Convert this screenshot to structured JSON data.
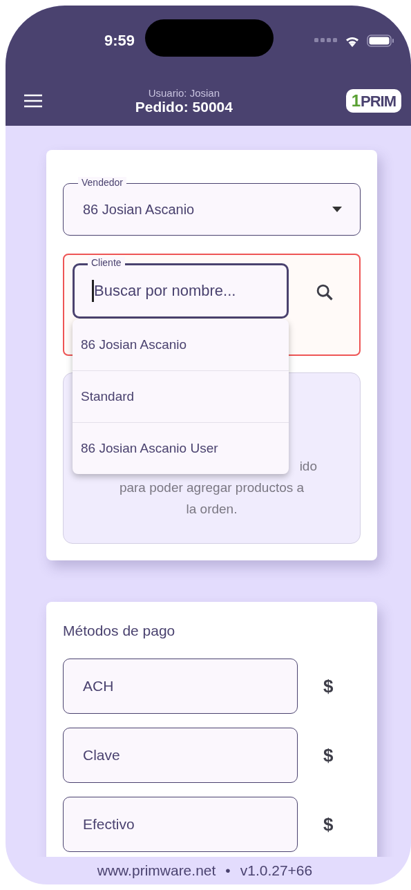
{
  "status_bar": {
    "time": "9:59"
  },
  "app_bar": {
    "user": "Usuario: Josian",
    "order": "Pedido: 50004",
    "logo": {
      "mark": "1",
      "text": "PRIM"
    }
  },
  "order_form": {
    "seller": {
      "label": "Vendedor",
      "value": "86 Josian Ascanio"
    },
    "client": {
      "label": "Cliente",
      "placeholder": "Buscar por nombre...",
      "error": true
    },
    "suggestions": [
      "86 Josian Ascanio",
      "Standard",
      "86 Josian Ascanio User"
    ],
    "notice_lines": [
      "ido",
      "para poder agregar productos a",
      "la orden."
    ]
  },
  "payment": {
    "title": "Métodos de pago",
    "methods": [
      {
        "label": "ACH",
        "currency": "$"
      },
      {
        "label": "Clave",
        "currency": "$"
      },
      {
        "label": "Efectivo",
        "currency": "$"
      }
    ]
  },
  "footer": {
    "site": "www.primware.net",
    "separator": "•",
    "version": "v1.0.27+66"
  }
}
